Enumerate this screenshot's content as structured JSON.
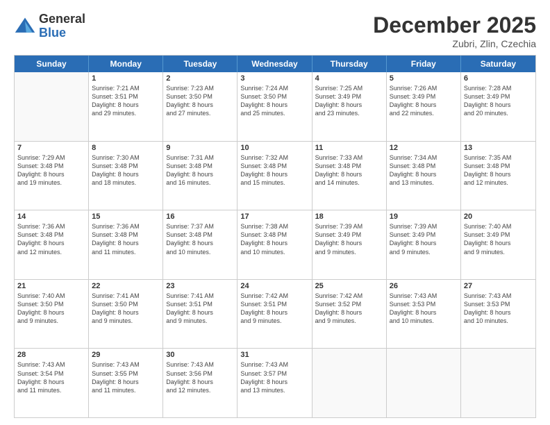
{
  "logo": {
    "general": "General",
    "blue": "Blue"
  },
  "title": "December 2025",
  "location": "Zubri, Zlin, Czechia",
  "days_of_week": [
    "Sunday",
    "Monday",
    "Tuesday",
    "Wednesday",
    "Thursday",
    "Friday",
    "Saturday"
  ],
  "weeks": [
    [
      {
        "day": "",
        "lines": []
      },
      {
        "day": "1",
        "lines": [
          "Sunrise: 7:21 AM",
          "Sunset: 3:51 PM",
          "Daylight: 8 hours",
          "and 29 minutes."
        ]
      },
      {
        "day": "2",
        "lines": [
          "Sunrise: 7:23 AM",
          "Sunset: 3:50 PM",
          "Daylight: 8 hours",
          "and 27 minutes."
        ]
      },
      {
        "day": "3",
        "lines": [
          "Sunrise: 7:24 AM",
          "Sunset: 3:50 PM",
          "Daylight: 8 hours",
          "and 25 minutes."
        ]
      },
      {
        "day": "4",
        "lines": [
          "Sunrise: 7:25 AM",
          "Sunset: 3:49 PM",
          "Daylight: 8 hours",
          "and 23 minutes."
        ]
      },
      {
        "day": "5",
        "lines": [
          "Sunrise: 7:26 AM",
          "Sunset: 3:49 PM",
          "Daylight: 8 hours",
          "and 22 minutes."
        ]
      },
      {
        "day": "6",
        "lines": [
          "Sunrise: 7:28 AM",
          "Sunset: 3:49 PM",
          "Daylight: 8 hours",
          "and 20 minutes."
        ]
      }
    ],
    [
      {
        "day": "7",
        "lines": [
          "Sunrise: 7:29 AM",
          "Sunset: 3:48 PM",
          "Daylight: 8 hours",
          "and 19 minutes."
        ]
      },
      {
        "day": "8",
        "lines": [
          "Sunrise: 7:30 AM",
          "Sunset: 3:48 PM",
          "Daylight: 8 hours",
          "and 18 minutes."
        ]
      },
      {
        "day": "9",
        "lines": [
          "Sunrise: 7:31 AM",
          "Sunset: 3:48 PM",
          "Daylight: 8 hours",
          "and 16 minutes."
        ]
      },
      {
        "day": "10",
        "lines": [
          "Sunrise: 7:32 AM",
          "Sunset: 3:48 PM",
          "Daylight: 8 hours",
          "and 15 minutes."
        ]
      },
      {
        "day": "11",
        "lines": [
          "Sunrise: 7:33 AM",
          "Sunset: 3:48 PM",
          "Daylight: 8 hours",
          "and 14 minutes."
        ]
      },
      {
        "day": "12",
        "lines": [
          "Sunrise: 7:34 AM",
          "Sunset: 3:48 PM",
          "Daylight: 8 hours",
          "and 13 minutes."
        ]
      },
      {
        "day": "13",
        "lines": [
          "Sunrise: 7:35 AM",
          "Sunset: 3:48 PM",
          "Daylight: 8 hours",
          "and 12 minutes."
        ]
      }
    ],
    [
      {
        "day": "14",
        "lines": [
          "Sunrise: 7:36 AM",
          "Sunset: 3:48 PM",
          "Daylight: 8 hours",
          "and 12 minutes."
        ]
      },
      {
        "day": "15",
        "lines": [
          "Sunrise: 7:36 AM",
          "Sunset: 3:48 PM",
          "Daylight: 8 hours",
          "and 11 minutes."
        ]
      },
      {
        "day": "16",
        "lines": [
          "Sunrise: 7:37 AM",
          "Sunset: 3:48 PM",
          "Daylight: 8 hours",
          "and 10 minutes."
        ]
      },
      {
        "day": "17",
        "lines": [
          "Sunrise: 7:38 AM",
          "Sunset: 3:48 PM",
          "Daylight: 8 hours",
          "and 10 minutes."
        ]
      },
      {
        "day": "18",
        "lines": [
          "Sunrise: 7:39 AM",
          "Sunset: 3:49 PM",
          "Daylight: 8 hours",
          "and 9 minutes."
        ]
      },
      {
        "day": "19",
        "lines": [
          "Sunrise: 7:39 AM",
          "Sunset: 3:49 PM",
          "Daylight: 8 hours",
          "and 9 minutes."
        ]
      },
      {
        "day": "20",
        "lines": [
          "Sunrise: 7:40 AM",
          "Sunset: 3:49 PM",
          "Daylight: 8 hours",
          "and 9 minutes."
        ]
      }
    ],
    [
      {
        "day": "21",
        "lines": [
          "Sunrise: 7:40 AM",
          "Sunset: 3:50 PM",
          "Daylight: 8 hours",
          "and 9 minutes."
        ]
      },
      {
        "day": "22",
        "lines": [
          "Sunrise: 7:41 AM",
          "Sunset: 3:50 PM",
          "Daylight: 8 hours",
          "and 9 minutes."
        ]
      },
      {
        "day": "23",
        "lines": [
          "Sunrise: 7:41 AM",
          "Sunset: 3:51 PM",
          "Daylight: 8 hours",
          "and 9 minutes."
        ]
      },
      {
        "day": "24",
        "lines": [
          "Sunrise: 7:42 AM",
          "Sunset: 3:51 PM",
          "Daylight: 8 hours",
          "and 9 minutes."
        ]
      },
      {
        "day": "25",
        "lines": [
          "Sunrise: 7:42 AM",
          "Sunset: 3:52 PM",
          "Daylight: 8 hours",
          "and 9 minutes."
        ]
      },
      {
        "day": "26",
        "lines": [
          "Sunrise: 7:43 AM",
          "Sunset: 3:53 PM",
          "Daylight: 8 hours",
          "and 10 minutes."
        ]
      },
      {
        "day": "27",
        "lines": [
          "Sunrise: 7:43 AM",
          "Sunset: 3:53 PM",
          "Daylight: 8 hours",
          "and 10 minutes."
        ]
      }
    ],
    [
      {
        "day": "28",
        "lines": [
          "Sunrise: 7:43 AM",
          "Sunset: 3:54 PM",
          "Daylight: 8 hours",
          "and 11 minutes."
        ]
      },
      {
        "day": "29",
        "lines": [
          "Sunrise: 7:43 AM",
          "Sunset: 3:55 PM",
          "Daylight: 8 hours",
          "and 11 minutes."
        ]
      },
      {
        "day": "30",
        "lines": [
          "Sunrise: 7:43 AM",
          "Sunset: 3:56 PM",
          "Daylight: 8 hours",
          "and 12 minutes."
        ]
      },
      {
        "day": "31",
        "lines": [
          "Sunrise: 7:43 AM",
          "Sunset: 3:57 PM",
          "Daylight: 8 hours",
          "and 13 minutes."
        ]
      },
      {
        "day": "",
        "lines": []
      },
      {
        "day": "",
        "lines": []
      },
      {
        "day": "",
        "lines": []
      }
    ]
  ]
}
